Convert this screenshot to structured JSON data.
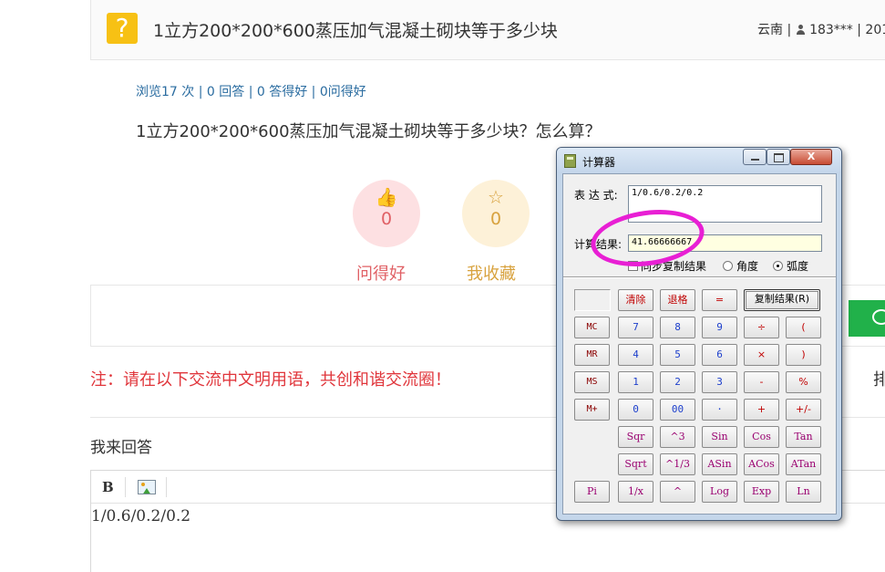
{
  "question": {
    "icon": "question-mark-icon",
    "icon_glyph": "?",
    "title": "1立方200*200*600蒸压加气混凝土砌块等于多少块",
    "meta_prefix": "云南 | ",
    "meta_user": "183*** | 201",
    "stats": "浏览17 次 | 0 回答 | 0 答得好 | 0问得好",
    "body": "1立方200*200*600蒸压加气混凝土砌块等于多少块？怎么算？"
  },
  "actions": {
    "good_question": {
      "icon": "thumbs-up-icon",
      "glyph": "👍",
      "count": "0",
      "label": "问得好"
    },
    "favorite": {
      "icon": "star-icon",
      "glyph": "☆",
      "count": "0",
      "label": "我收藏"
    }
  },
  "notice": "注：请在以下交流中文明用语，共创和谐交流圈！",
  "right_clipped_char": "排",
  "answer": {
    "heading": "我来回答",
    "bold_label": "B",
    "content": "1/0.6/0.2/0.2"
  },
  "calculator": {
    "window_title": "计算器",
    "close_glyph": "X",
    "expr_label": "表 达 式:",
    "expr_value": "1/0.6/0.2/0.2",
    "result_label": "计算结果:",
    "result_value": "41.66666667",
    "sync_label": "同步复制结果",
    "angle_label": "角度",
    "radian_label": "弧度",
    "radian_selected": true,
    "buttons": {
      "clear": "清除",
      "backspace": "退格",
      "equals": "=",
      "copy": "复制结果(R)",
      "mc": "MC",
      "mr": "MR",
      "ms": "MS",
      "mplus": "M+",
      "n7": "7",
      "n8": "8",
      "n9": "9",
      "div": "÷",
      "lparen": "(",
      "n4": "4",
      "n5": "5",
      "n6": "6",
      "mul": "×",
      "rparen": ")",
      "n1": "1",
      "n2": "2",
      "n3": "3",
      "sub": "-",
      "pct": "%",
      "n0": "0",
      "n00": "00",
      "dot": "·",
      "add": "+",
      "neg": "+/-",
      "sqr": "Sqr",
      "cube": "^3",
      "sin": "Sin",
      "cos": "Cos",
      "tan": "Tan",
      "sqrt": "Sqrt",
      "cbrt": "^1/3",
      "asin": "ASin",
      "acos": "ACos",
      "atan": "ATan",
      "pi": "Pi",
      "inv": "1/x",
      "pow": "^",
      "log": "Log",
      "exp": "Exp",
      "ln": "Ln"
    }
  },
  "annotation_color": "#e81fd4"
}
